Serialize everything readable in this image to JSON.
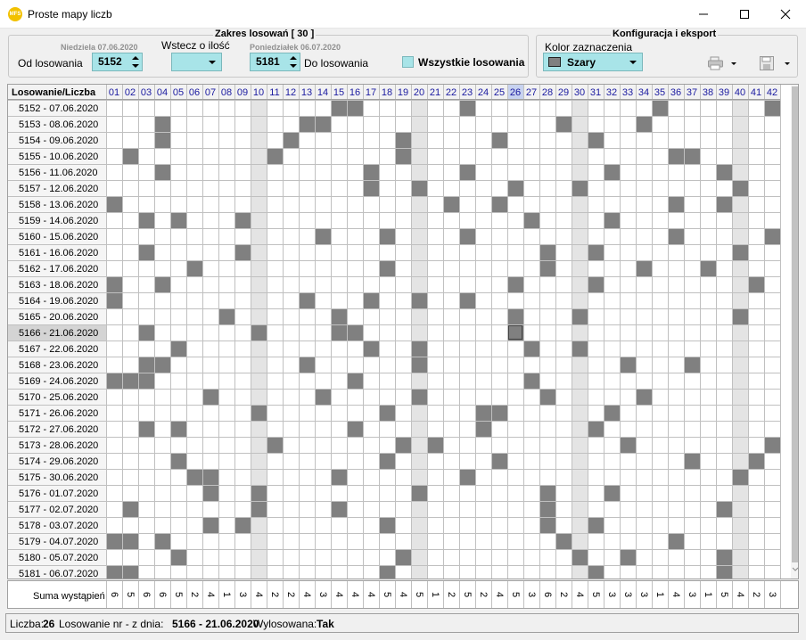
{
  "window": {
    "title": "Proste mapy liczb",
    "app_icon_text": "MFS"
  },
  "range": {
    "legend": "Zakres losowań  [ 30 ]",
    "from_day_label": "Niedziela 07.06.2020",
    "from_label": "Od losowania",
    "from_value": "5152",
    "back_label": "Wstecz o ilość",
    "back_value": "",
    "to_day_label": "Poniedziałek 06.07.2020",
    "to_value": "5181",
    "to_label": "Do losowania",
    "all_label": "Wszystkie losowania"
  },
  "config": {
    "legend": "Konfiguracja i eksport",
    "color_label": "Kolor zaznaczenia",
    "color_value": "Szary"
  },
  "grid": {
    "header_label": "Losowanie/Liczba",
    "numbers": [
      "01",
      "02",
      "03",
      "04",
      "05",
      "06",
      "07",
      "08",
      "09",
      "10",
      "11",
      "12",
      "13",
      "14",
      "15",
      "16",
      "17",
      "18",
      "19",
      "20",
      "21",
      "22",
      "23",
      "24",
      "25",
      "26",
      "27",
      "28",
      "29",
      "30",
      "31",
      "32",
      "33",
      "34",
      "35",
      "36",
      "37",
      "38",
      "39",
      "40",
      "41",
      "42"
    ],
    "highlight_columns": [
      10,
      20,
      30,
      40
    ],
    "selected_number": 26,
    "selected_row_index": 14,
    "colors": {
      "hit": "#808080",
      "column_shade": "#e4e4e4",
      "header_text": "#1a1aa0"
    },
    "rows": [
      {
        "label": "5152 - 07.06.2020",
        "hits": [
          15,
          16,
          23,
          35,
          42
        ]
      },
      {
        "label": "5153 - 08.06.2020",
        "hits": [
          4,
          13,
          14,
          29,
          34
        ]
      },
      {
        "label": "5154 - 09.06.2020",
        "hits": [
          4,
          12,
          19,
          25,
          31
        ]
      },
      {
        "label": "5155 - 10.06.2020",
        "hits": [
          2,
          11,
          19,
          36,
          37
        ]
      },
      {
        "label": "5156 - 11.06.2020",
        "hits": [
          4,
          17,
          23,
          32,
          39
        ]
      },
      {
        "label": "5157 - 12.06.2020",
        "hits": [
          17,
          20,
          26,
          30,
          40
        ]
      },
      {
        "label": "5158 - 13.06.2020",
        "hits": [
          1,
          22,
          25,
          36,
          39
        ]
      },
      {
        "label": "5159 - 14.06.2020",
        "hits": [
          3,
          5,
          9,
          27,
          32
        ]
      },
      {
        "label": "5160 - 15.06.2020",
        "hits": [
          14,
          18,
          23,
          36,
          42
        ]
      },
      {
        "label": "5161 - 16.06.2020",
        "hits": [
          3,
          9,
          28,
          31,
          40
        ]
      },
      {
        "label": "5162 - 17.06.2020",
        "hits": [
          6,
          18,
          28,
          34,
          38
        ]
      },
      {
        "label": "5163 - 18.06.2020",
        "hits": [
          1,
          4,
          26,
          31,
          41
        ]
      },
      {
        "label": "5164 - 19.06.2020",
        "hits": [
          1,
          13,
          17,
          20,
          23
        ]
      },
      {
        "label": "5165 - 20.06.2020",
        "hits": [
          8,
          15,
          26,
          30,
          40
        ]
      },
      {
        "label": "5166 - 21.06.2020",
        "hits": [
          3,
          10,
          15,
          16,
          26
        ]
      },
      {
        "label": "5167 - 22.06.2020",
        "hits": [
          5,
          17,
          20,
          27,
          30
        ]
      },
      {
        "label": "5168 - 23.06.2020",
        "hits": [
          3,
          4,
          13,
          20,
          33,
          37
        ]
      },
      {
        "label": "5169 - 24.06.2020",
        "hits": [
          1,
          2,
          3,
          16,
          27
        ]
      },
      {
        "label": "5170 - 25.06.2020",
        "hits": [
          7,
          14,
          20,
          28,
          34
        ]
      },
      {
        "label": "5171 - 26.06.2020",
        "hits": [
          10,
          18,
          24,
          25,
          32
        ]
      },
      {
        "label": "5172 - 27.06.2020",
        "hits": [
          3,
          5,
          16,
          24,
          31
        ]
      },
      {
        "label": "5173 - 28.06.2020",
        "hits": [
          11,
          19,
          21,
          33,
          42
        ]
      },
      {
        "label": "5174 - 29.06.2020",
        "hits": [
          5,
          18,
          25,
          37,
          41
        ]
      },
      {
        "label": "5175 - 30.06.2020",
        "hits": [
          6,
          7,
          15,
          23,
          40
        ]
      },
      {
        "label": "5176 - 01.07.2020",
        "hits": [
          7,
          10,
          20,
          28,
          32
        ]
      },
      {
        "label": "5177 - 02.07.2020",
        "hits": [
          2,
          10,
          15,
          28,
          39
        ]
      },
      {
        "label": "5178 - 03.07.2020",
        "hits": [
          7,
          9,
          18,
          28,
          31
        ]
      },
      {
        "label": "5179 - 04.07.2020",
        "hits": [
          1,
          2,
          4,
          29,
          36
        ]
      },
      {
        "label": "5180 - 05.07.2020",
        "hits": [
          5,
          19,
          30,
          33,
          39
        ]
      },
      {
        "label": "5181 - 06.07.2020",
        "hits": [
          1,
          2,
          18,
          31,
          39
        ]
      }
    ]
  },
  "sums": {
    "label": "Suma wystąpień",
    "values": [
      "6",
      "5",
      "6",
      "6",
      "5",
      "2",
      "4",
      "1",
      "3",
      "4",
      "2",
      "2",
      "4",
      "3",
      "4",
      "4",
      "4",
      "5",
      "4",
      "5",
      "1",
      "2",
      "5",
      "2",
      "4",
      "5",
      "3",
      "6",
      "2",
      "4",
      "5",
      "3",
      "3",
      "3",
      "1",
      "4",
      "3",
      "1",
      "5",
      "4",
      "2",
      "3"
    ]
  },
  "status": {
    "number_label": "Liczba:",
    "number_value": "26",
    "draw_label": "Losowanie nr - z dnia:",
    "draw_value": "5166 - 21.06.2020",
    "drawn_label": "Wylosowana:",
    "drawn_value": "Tak"
  }
}
